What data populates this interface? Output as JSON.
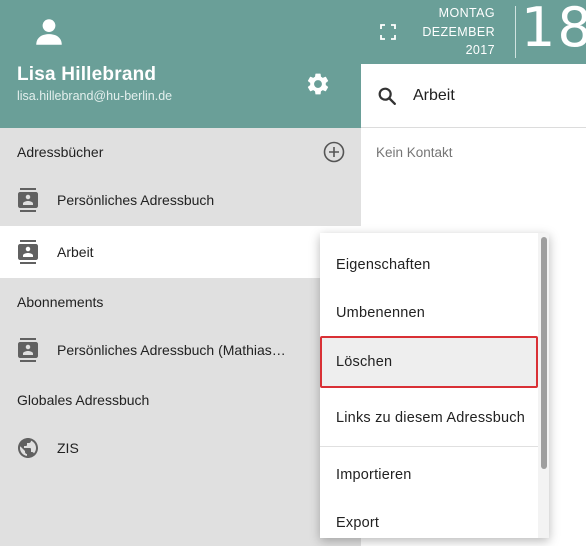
{
  "user": {
    "name": "Lisa Hillebrand",
    "email": "lisa.hillebrand@hu-berlin.de"
  },
  "sidebar": {
    "addressbooks_title": "Adressbücher",
    "subscriptions_title": "Abonnements",
    "global_title": "Globales Adressbuch",
    "books": [
      {
        "label": "Persönliches Adressbuch",
        "icon": "contact-book-icon"
      },
      {
        "label": "Arbeit",
        "icon": "contact-book-icon",
        "active": true
      }
    ],
    "subscriptions": [
      {
        "label": "Persönliches Adressbuch (Mathias…",
        "icon": "contact-book-icon"
      }
    ],
    "global": [
      {
        "label": "ZIS",
        "icon": "globe-icon"
      }
    ]
  },
  "date": {
    "weekday": "MONTAG",
    "month": "DEZEMBER",
    "year": "2017",
    "day": "18"
  },
  "search": {
    "value": "Arbeit",
    "placeholder": ""
  },
  "contacts": {
    "empty_message": "Kein Kontakt"
  },
  "context_menu": {
    "items": [
      {
        "label": "Eigenschaften"
      },
      {
        "label": "Umbenennen"
      },
      {
        "label": "Löschen",
        "highlighted": true
      },
      {
        "label": "Links zu diesem Adressbuch"
      },
      {
        "label": "Importieren"
      },
      {
        "label": "Export"
      }
    ]
  },
  "colors": {
    "header_teal": "#6a9f98",
    "sidebar_bg": "#e0e0e0",
    "highlight_border": "#d93035"
  }
}
